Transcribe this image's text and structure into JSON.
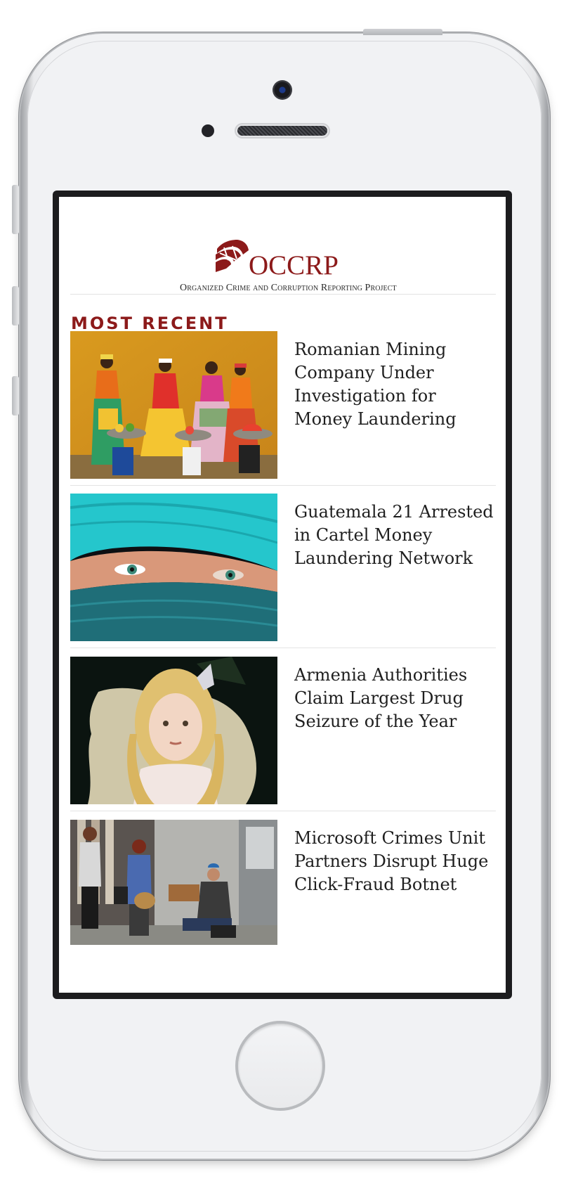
{
  "brand": {
    "logo_word": "OCCRP",
    "logo_tagline": "Organized Crime and Corruption Reporting Project",
    "color": "#8c1a1a"
  },
  "section": {
    "title": "MOST RECENT"
  },
  "articles": [
    {
      "title": "Romanian Mining Company Under Investigation for Money Laundering",
      "image": "women-in-colorful-dresses-with-fruit"
    },
    {
      "title": "Guatemala 21 Arrested in Cartel Money Laundering Network",
      "image": "eyes-behind-turquoise-scarf"
    },
    {
      "title": "Armenia Authorities Claim Largest Drug Seizure of the Year",
      "image": "girl-with-curly-hair-and-map"
    },
    {
      "title": "Microsoft Crimes Unit Partners Disrupt Huge Click-Fraud Botnet",
      "image": "street-scene-with-beggar"
    }
  ]
}
